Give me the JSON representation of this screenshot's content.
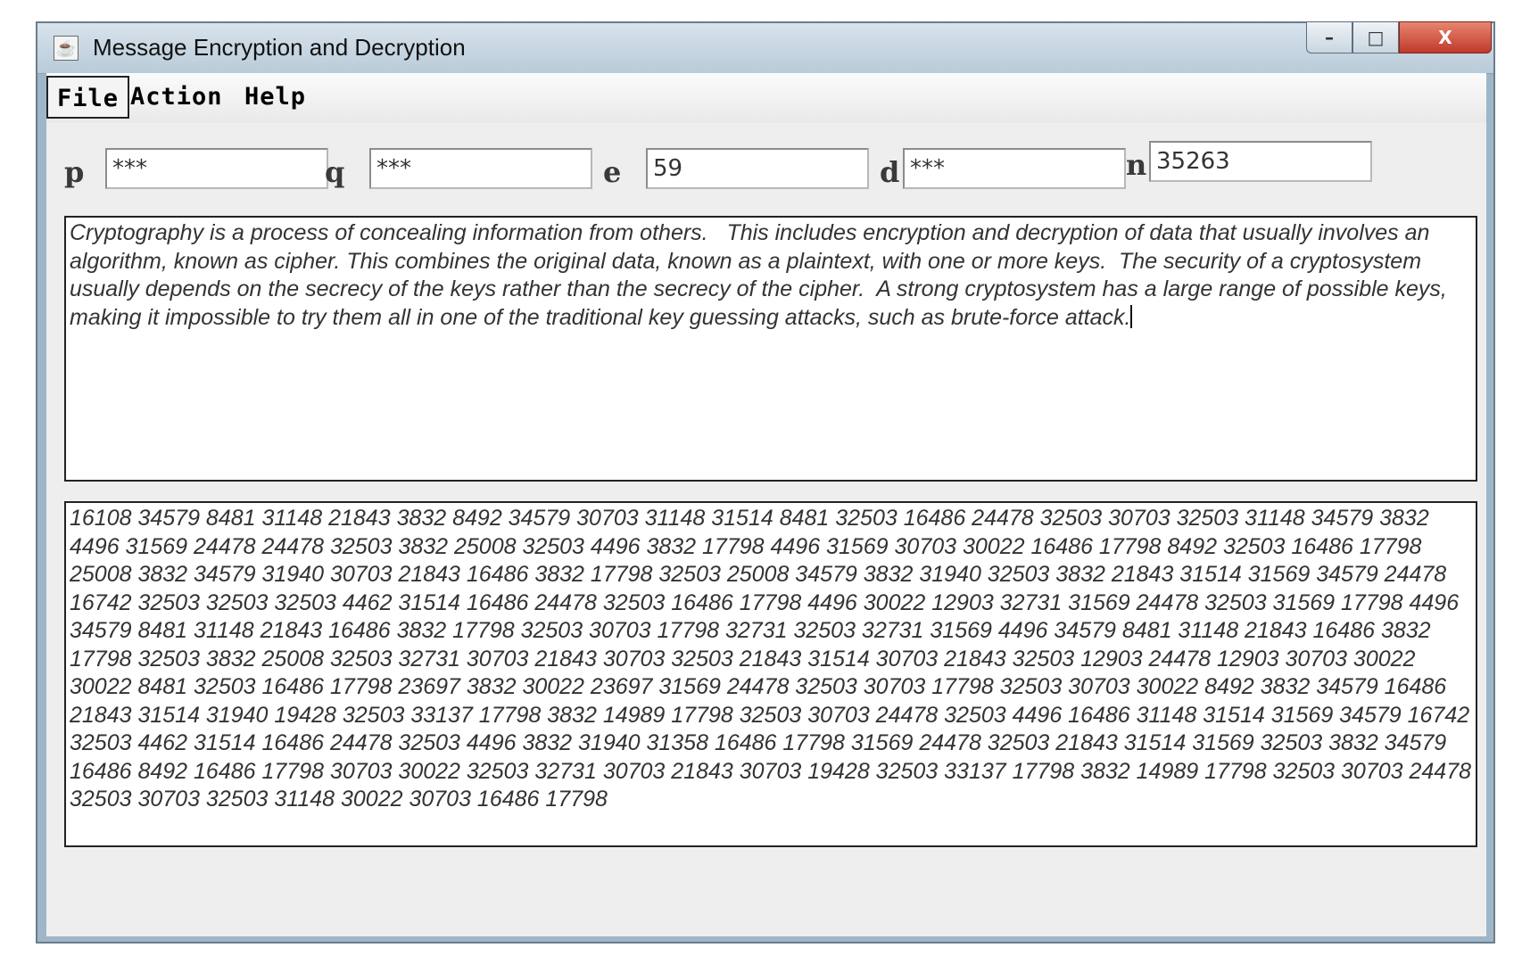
{
  "window": {
    "title": "Message Encryption and Decryption",
    "controls": {
      "minimize": "–",
      "maximize": "□",
      "close": "X"
    }
  },
  "menu": {
    "items": [
      "File",
      "Action",
      "Help"
    ]
  },
  "keys": {
    "p": {
      "label": "p",
      "value": "***"
    },
    "q": {
      "label": "q",
      "value": "***"
    },
    "e": {
      "label": "e",
      "value": "59"
    },
    "d": {
      "label": "d",
      "value": "***"
    },
    "n": {
      "label": "n",
      "value": "35263"
    }
  },
  "plaintext": "Cryptography is a process of concealing information from others.   This includes encryption and decryption of data that usually involves an algorithm, known as cipher. This combines the original data, known as a plaintext, with one or more keys.  The security of a cryptosystem usually depends on the secrecy of the keys rather than the secrecy of the cipher.  A strong cryptosystem has a large range of possible keys, making it impossible to try them all in one of the traditional key guessing attacks, such as brute-force attack.",
  "ciphertext": "16108 34579 8481 31148 21843 3832 8492 34579 30703 31148 31514 8481 32503 16486 24478 32503 30703 32503 31148 34579 3832 4496 31569 24478 24478 32503 3832 25008 32503 4496 3832 17798 4496 31569 30703 30022 16486 17798 8492 32503 16486 17798 25008 3832 34579 31940 30703 21843 16486 3832 17798 32503 25008 34579 3832 31940 32503 3832 21843 31514 31569 34579 24478 16742 32503 32503 32503 4462 31514 16486 24478 32503 16486 17798 4496 30022 12903 32731 31569 24478 32503 31569 17798 4496 34579 8481 31148 21843 16486 3832 17798 32503 30703 17798 32731 32503 32731 31569 4496 34579 8481 31148 21843 16486 3832 17798 32503 3832 25008 32503 32731 30703 21843 30703 32503 21843 31514 30703 21843 32503 12903 24478 12903 30703 30022 30022 8481 32503 16486 17798 23697 3832 30022 23697 31569 24478 32503 30703 17798 32503 30703 30022 8492 3832 34579 16486 21843 31514 31940 19428 32503 33137 17798 3832 14989 17798 32503 30703 24478 32503 4496 16486 31148 31514 31569 34579 16742 32503 4462 31514 16486 24478 32503 4496 3832 31940 31358 16486 17798 31569 24478 32503 21843 31514 31569 32503 3832 34579 16486 8492 16486 17798 30703 30022 32503 32731 30703 21843 30703 19428 32503 33137 17798 3832 14989 17798 32503 30703 24478 32503 30703 32503 31148 30022 30703 16486 17798"
}
